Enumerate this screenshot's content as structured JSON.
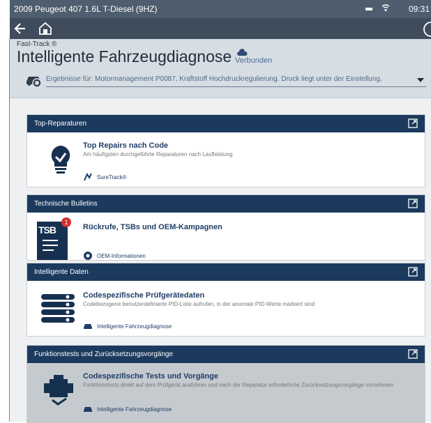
{
  "statusbar": {
    "vehicle": "2009 Peugeot 407 1.6L T-Diesel (9HZ)",
    "time": "09:31"
  },
  "header": {
    "fasttrack": "Fast-Track ®",
    "title": "Intelligente Fahrzeugdiagnose",
    "connection_status": "Verbunden",
    "results": "Ergebnisse für: Motormanagement P0087, Kraftstoff Hochdruckregulierung. Druck liegt unter der Einstellung."
  },
  "cards": {
    "top_repairs": {
      "header": "Top-Reparaturen",
      "title": "Top Repairs nach Code",
      "desc": "Am häufigsten durchgeführte Reparaturen nach Laufleistung",
      "link": "SureTrack®"
    },
    "bulletins": {
      "header": "Technische Bulletins",
      "title": "Rückrufe, TSBs und OEM-Kampagnen",
      "link": "OEM-Informationen",
      "badge": "1",
      "icon_text": "TSB"
    },
    "smart_data": {
      "header": "Intelligente Daten",
      "title": "Codespezifische Prüfgerätedaten",
      "desc": "Codebezogene benutzerdefinierte PID-Liste aufrufen, in der anomale PID-Werte markiert sind",
      "link": "Intelligente Fahrzeugdiagnose"
    },
    "tests": {
      "header": "Funktionstests und Zurücksetzungsvorgänge",
      "title": "Codespezifische Tests und Vorgänge",
      "desc": "Funktionstests direkt auf dem Prüfgerät ausführen und nach der Reparatur erforderliche Zurücksetzungsvorgänge vornehmen",
      "link": "Intelligente Fahrzeugdiagnose"
    }
  },
  "colors": {
    "header_blue": "#1c3a5e",
    "badge_red": "#d32f2f",
    "title_blue": "#1f3e66"
  }
}
